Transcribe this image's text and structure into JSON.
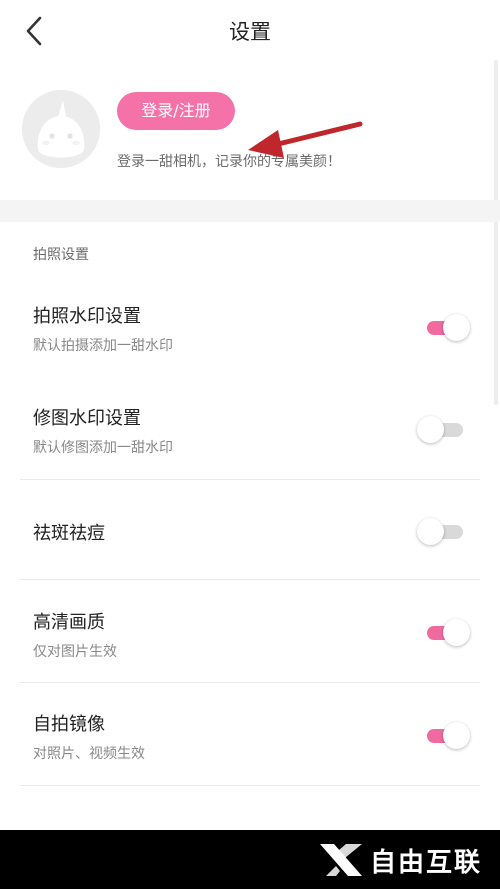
{
  "header": {
    "title": "设置",
    "back_icon": "chevron-left-icon"
  },
  "profile": {
    "avatar_icon": "unicorn-avatar-icon",
    "login_label": "登录/注册",
    "hint": "登录一甜相机，记录你的专属美颜！"
  },
  "settings": {
    "section_title": "拍照设置",
    "items": [
      {
        "title": "拍照水印设置",
        "subtitle": "默认拍摄添加一甜水印",
        "enabled": true
      },
      {
        "title": "修图水印设置",
        "subtitle": "默认修图添加一甜水印",
        "enabled": false
      },
      {
        "title": "祛斑祛痘",
        "subtitle": "",
        "enabled": false
      },
      {
        "title": "高清画质",
        "subtitle": "仅对图片生效",
        "enabled": true
      },
      {
        "title": "自拍镜像",
        "subtitle": "对照片、视频生效",
        "enabled": true
      }
    ]
  },
  "watermark": {
    "text": "自由互联",
    "icon": "x-logo-icon"
  },
  "colors": {
    "accent": "#f472a8",
    "toggle_on": "#f06aa0",
    "toggle_off": "#d9d9d9",
    "annotation_arrow": "#c0272d"
  }
}
